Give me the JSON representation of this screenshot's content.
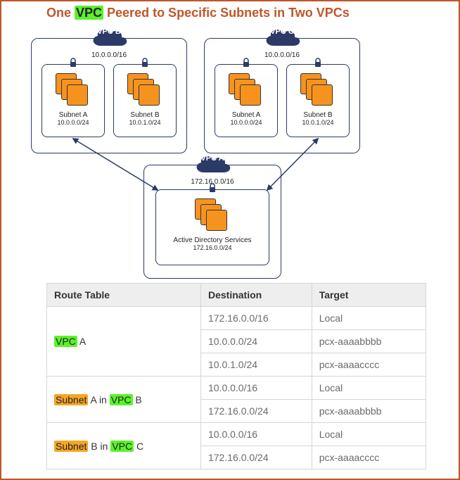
{
  "title": {
    "pre": "One ",
    "vpc": "VPC",
    "post": " Peered to Specific Subnets in Two VPCs"
  },
  "vpcB": {
    "label": "VPC B",
    "cidr": "10.0.0.0/16",
    "subnetA": {
      "name": "Subnet A",
      "cidr": "10.0.0.0/24"
    },
    "subnetB": {
      "name": "Subnet B",
      "cidr": "10.0.1.0/24"
    }
  },
  "vpcC": {
    "label": "VPC C",
    "cidr": "10.0.0.0/16",
    "subnetA": {
      "name": "Subnet A",
      "cidr": "10.0.0.0/24"
    },
    "subnetB": {
      "name": "Subnet B",
      "cidr": "10.0.1.0/24"
    }
  },
  "vpcA": {
    "label": "VPC A",
    "cidr": "172.16.0.0/16",
    "subnet": {
      "name": "Active Directory Services",
      "cidr": "172.16.0.0/24"
    }
  },
  "table": {
    "headers": {
      "c0": "Route Table",
      "c1": "Destination",
      "c2": "Target"
    },
    "rows": [
      {
        "rt_pre": "",
        "rt_hl1": "VPC",
        "rt_hl1_class": "green",
        "rt_mid": " A",
        "dest": "172.16.0.0/16",
        "tgt": "Local"
      },
      {
        "dest": "10.0.0.0/24",
        "tgt": "pcx-aaaabbbb"
      },
      {
        "dest": "10.0.1.0/24",
        "tgt": "pcx-aaaacccc"
      },
      {
        "rt_hl1": "Subnet",
        "rt_hl1_class": "orange",
        "rt_mid": " A in ",
        "rt_hl2": "VPC",
        "rt_hl2_class": "green",
        "rt_post": " B",
        "dest": "10.0.0.0/16",
        "tgt": "Local"
      },
      {
        "dest": "172.16.0.0/24",
        "tgt": "pcx-aaaabbbb"
      },
      {
        "rt_hl1": "Subnet",
        "rt_hl1_class": "orange",
        "rt_mid": " B in ",
        "rt_hl2": "VPC",
        "rt_hl2_class": "green",
        "rt_post": " C",
        "dest": "10.0.0.0/16",
        "tgt": "Local"
      },
      {
        "dest": "172.16.0.0/24",
        "tgt": "pcx-aaaacccc"
      }
    ]
  }
}
